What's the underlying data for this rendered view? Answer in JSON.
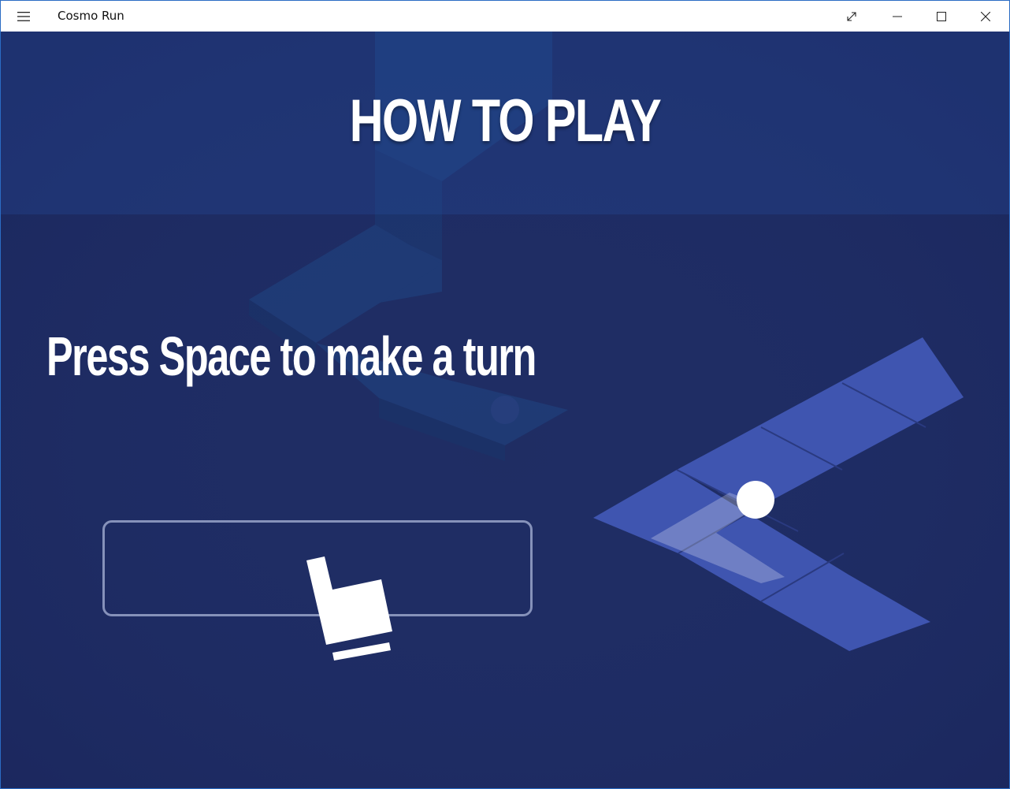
{
  "window": {
    "app_title": "Cosmo Run",
    "menu_icon": "hamburger-menu-icon",
    "controls": [
      "fullscreen-icon",
      "minimize-icon",
      "maximize-icon",
      "close-icon"
    ]
  },
  "screen": {
    "heading": "HOW TO PLAY",
    "instruction": "Press Space to make a turn"
  },
  "colors": {
    "background": "#1f2d63",
    "header_band": "#2a4d9a",
    "tile": "#3f55b0",
    "text": "#ffffff",
    "key_outline": "#aab4d7"
  },
  "icons": {
    "hand": "pressing-hand-icon",
    "ball": "ball-icon"
  }
}
